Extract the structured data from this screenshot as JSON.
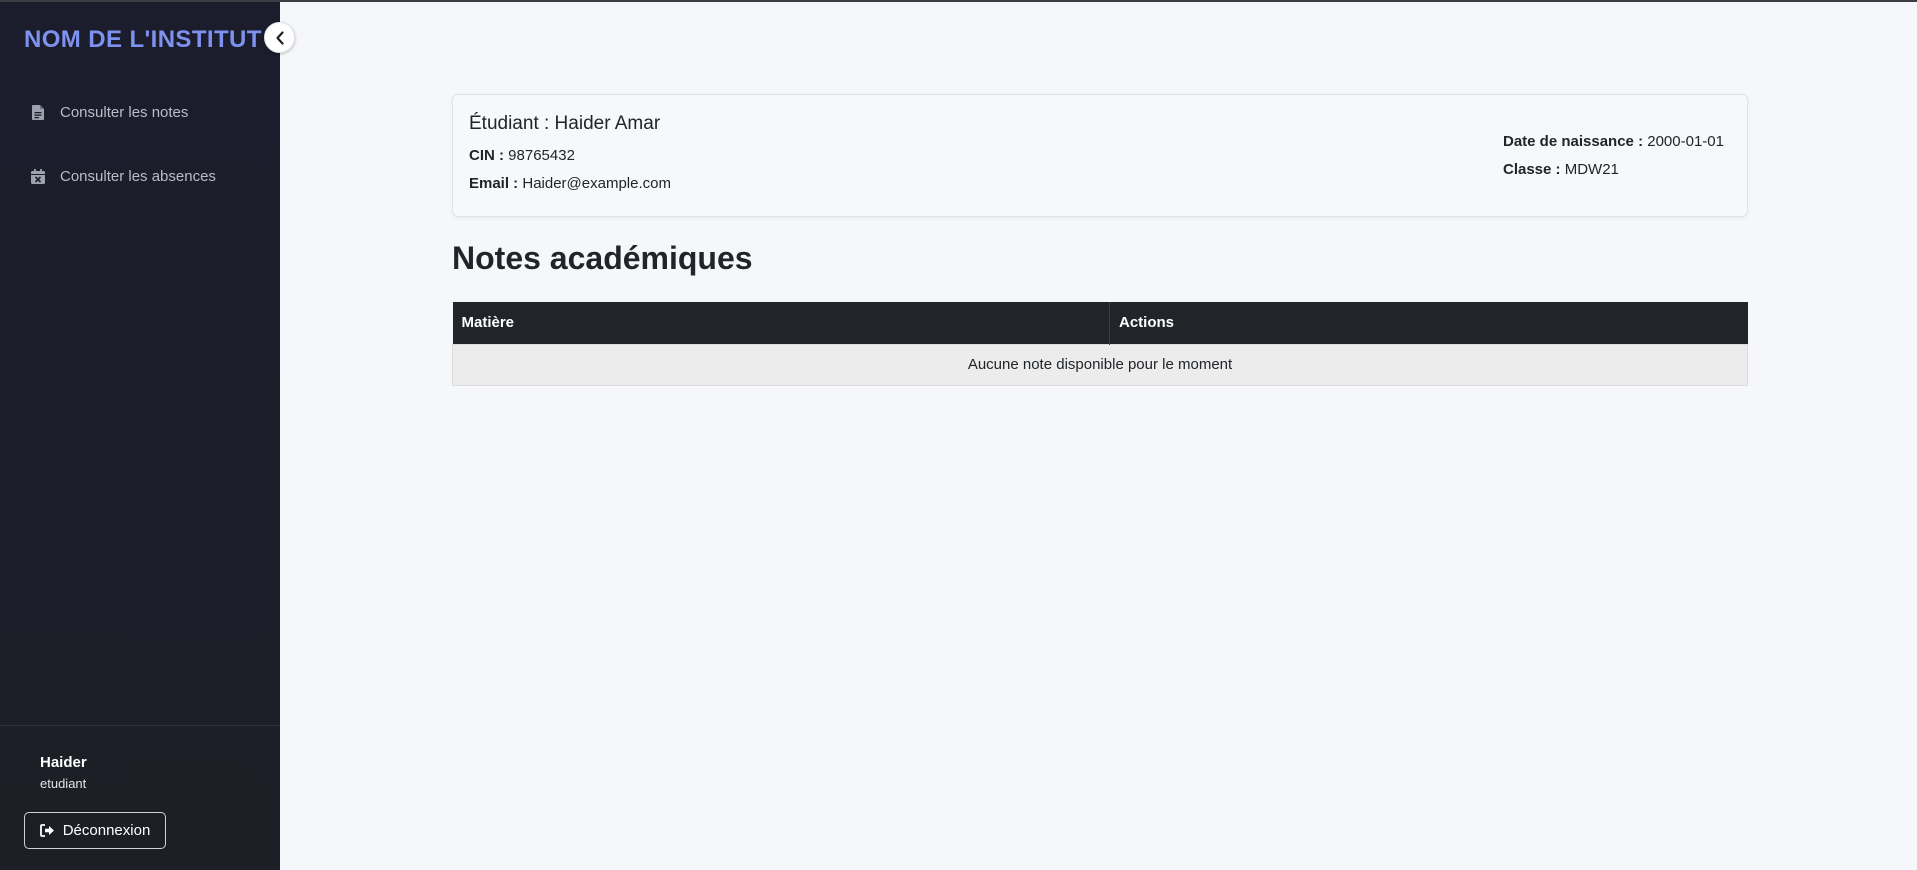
{
  "sidebar": {
    "brand": "NOM DE L'INSTITUT",
    "items": [
      {
        "label": "Consulter les notes",
        "icon": "file-text-icon"
      },
      {
        "label": "Consulter les absences",
        "icon": "calendar-x-icon"
      }
    ],
    "user": {
      "name": "Haider",
      "role": "etudiant"
    },
    "logout_label": "Déconnexion",
    "collapse_icon": "chevron-left-icon"
  },
  "student": {
    "name_line": "Étudiant : Haider Amar",
    "cin_label": "CIN :",
    "cin_value": "98765432",
    "email_label": "Email :",
    "email_value": "Haider@example.com",
    "birth_label": "Date de naissance :",
    "birth_value": "2000-01-01",
    "class_label": "Classe :",
    "class_value": "MDW21"
  },
  "notes": {
    "title": "Notes académiques",
    "columns": [
      "Matière",
      "Actions"
    ],
    "empty_message": "Aucune note disponible pour le moment"
  },
  "colors": {
    "brand": "#7e91ee",
    "sidebar_bg": "#1c1e2a",
    "table_header_bg": "#212529",
    "page_bg": "#f6f7fa"
  }
}
